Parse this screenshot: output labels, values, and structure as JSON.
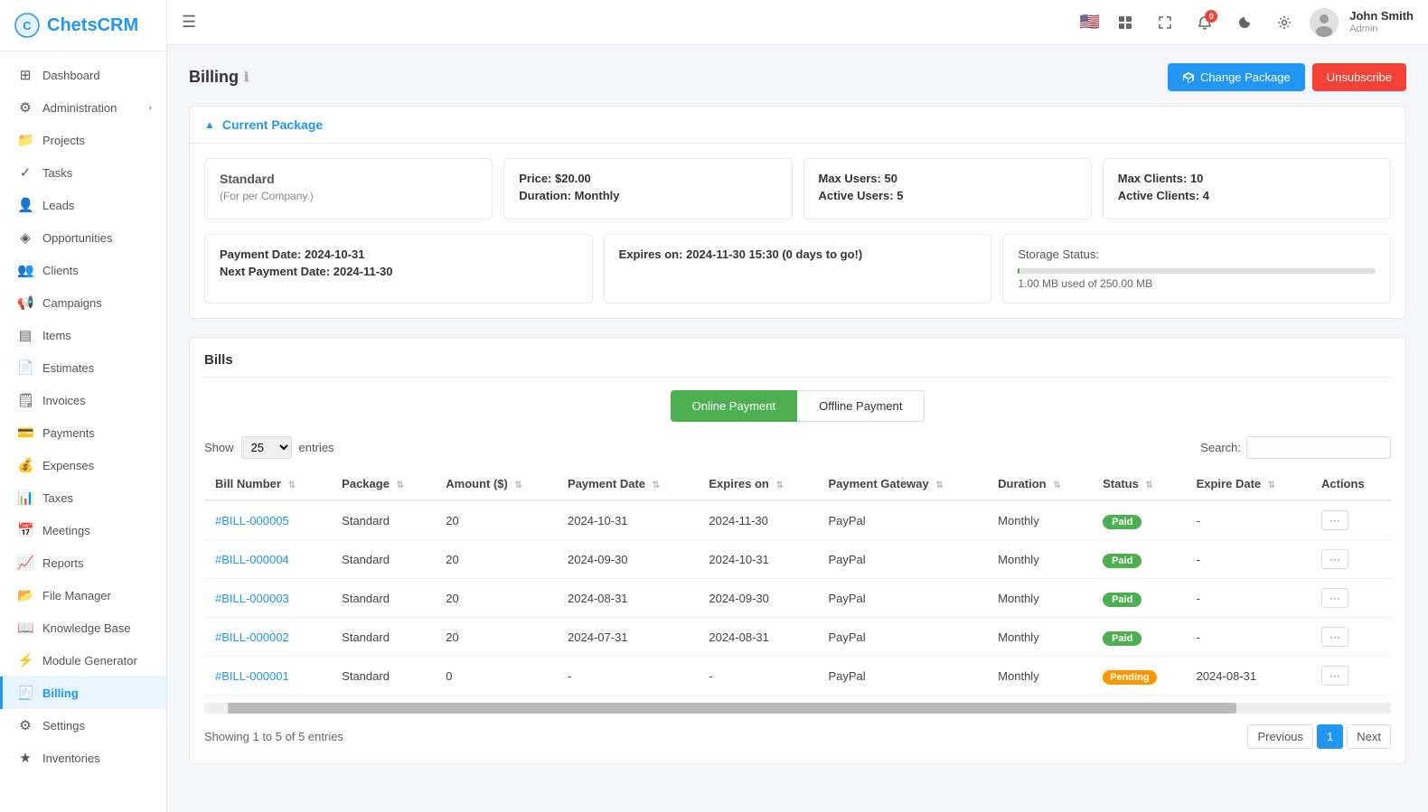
{
  "app": {
    "name": "ChetsCRM",
    "logo_text": "ChetsCRM"
  },
  "sidebar": {
    "items": [
      {
        "id": "dashboard",
        "label": "Dashboard",
        "icon": "⊞",
        "active": false
      },
      {
        "id": "administration",
        "label": "Administration",
        "icon": "⚙",
        "active": false,
        "has_arrow": true
      },
      {
        "id": "projects",
        "label": "Projects",
        "icon": "📁",
        "active": false
      },
      {
        "id": "tasks",
        "label": "Tasks",
        "icon": "✓",
        "active": false
      },
      {
        "id": "leads",
        "label": "Leads",
        "icon": "👤",
        "active": false
      },
      {
        "id": "opportunities",
        "label": "Opportunities",
        "icon": "◈",
        "active": false
      },
      {
        "id": "clients",
        "label": "Clients",
        "icon": "👥",
        "active": false
      },
      {
        "id": "campaigns",
        "label": "Campaigns",
        "icon": "📢",
        "active": false
      },
      {
        "id": "items",
        "label": "Items",
        "icon": "▤",
        "active": false
      },
      {
        "id": "estimates",
        "label": "Estimates",
        "icon": "📄",
        "active": false
      },
      {
        "id": "invoices",
        "label": "Invoices",
        "icon": "🗒",
        "active": false
      },
      {
        "id": "payments",
        "label": "Payments",
        "icon": "💳",
        "active": false
      },
      {
        "id": "expenses",
        "label": "Expenses",
        "icon": "💰",
        "active": false
      },
      {
        "id": "taxes",
        "label": "Taxes",
        "icon": "📊",
        "active": false
      },
      {
        "id": "meetings",
        "label": "Meetings",
        "icon": "📅",
        "active": false
      },
      {
        "id": "reports",
        "label": "Reports",
        "icon": "📈",
        "active": false
      },
      {
        "id": "file-manager",
        "label": "File Manager",
        "icon": "📂",
        "active": false
      },
      {
        "id": "knowledge-base",
        "label": "Knowledge Base",
        "icon": "📖",
        "active": false
      },
      {
        "id": "module-generator",
        "label": "Module Generator",
        "icon": "⚡",
        "active": false
      },
      {
        "id": "billing",
        "label": "Billing",
        "icon": "🧾",
        "active": true
      },
      {
        "id": "settings",
        "label": "Settings",
        "icon": "⚙",
        "active": false
      },
      {
        "id": "inventories",
        "label": "Inventories",
        "icon": "★",
        "active": false
      }
    ]
  },
  "header": {
    "hamburger_label": "☰",
    "flag": "🇺🇸",
    "apps_icon": "⊞",
    "expand_icon": "⛶",
    "notification_count": "0",
    "moon_icon": "☾",
    "settings_icon": "⚙",
    "user": {
      "name": "John Smith",
      "role": "Admin"
    }
  },
  "page": {
    "title": "Billing",
    "info_icon": "ℹ",
    "change_package_label": "Change Package",
    "unsubscribe_label": "Unsubscribe"
  },
  "current_package": {
    "section_title": "Current Package",
    "package_name": "Standard",
    "package_sub": "(For per Company.)",
    "price_label": "Price:",
    "price_value": "$20.00",
    "duration_label": "Duration:",
    "duration_value": "Monthly",
    "max_users_label": "Max Users:",
    "max_users_value": "50",
    "active_users_label": "Active Users:",
    "active_users_value": "5",
    "max_clients_label": "Max Clients:",
    "max_clients_value": "10",
    "active_clients_label": "Active Clients:",
    "active_clients_value": "4",
    "payment_date_label": "Payment Date:",
    "payment_date_value": "2024-10-31",
    "next_payment_label": "Next Payment Date:",
    "next_payment_value": "2024-11-30",
    "expires_label": "Expires on:",
    "expires_value": "2024-11-30 15:30 (0 days to go!)",
    "storage_label": "Storage Status:",
    "storage_used": "1.00 MB used of 250.00 MB",
    "storage_fill_percent": 0.4
  },
  "bills": {
    "title": "Bills",
    "online_payment_label": "Online Payment",
    "offline_payment_label": "Offline Payment",
    "show_label": "Show",
    "show_value": "25",
    "entries_label": "entries",
    "search_label": "Search:",
    "search_placeholder": "",
    "columns": [
      "Bill Number",
      "Package",
      "Amount ($)",
      "Payment Date",
      "Expires on",
      "Payment Gateway",
      "Duration",
      "Status",
      "Expire Date",
      "Actions"
    ],
    "rows": [
      {
        "bill_number": "#BILL-000005",
        "package": "Standard",
        "amount": "20",
        "payment_date": "2024-10-31",
        "expires_on": "2024-11-30",
        "gateway": "PayPal",
        "duration": "Monthly",
        "status": "Paid",
        "status_type": "paid",
        "expire_date": "-",
        "actions": "···"
      },
      {
        "bill_number": "#BILL-000004",
        "package": "Standard",
        "amount": "20",
        "payment_date": "2024-09-30",
        "expires_on": "2024-10-31",
        "gateway": "PayPal",
        "duration": "Monthly",
        "status": "Paid",
        "status_type": "paid",
        "expire_date": "-",
        "actions": "···"
      },
      {
        "bill_number": "#BILL-000003",
        "package": "Standard",
        "amount": "20",
        "payment_date": "2024-08-31",
        "expires_on": "2024-09-30",
        "gateway": "PayPal",
        "duration": "Monthly",
        "status": "Paid",
        "status_type": "paid",
        "expire_date": "-",
        "actions": "···"
      },
      {
        "bill_number": "#BILL-000002",
        "package": "Standard",
        "amount": "20",
        "payment_date": "2024-07-31",
        "expires_on": "2024-08-31",
        "gateway": "PayPal",
        "duration": "Monthly",
        "status": "Paid",
        "status_type": "paid",
        "expire_date": "-",
        "actions": "···"
      },
      {
        "bill_number": "#BILL-000001",
        "package": "Standard",
        "amount": "0",
        "payment_date": "-",
        "expires_on": "-",
        "gateway": "PayPal",
        "duration": "Monthly",
        "status": "Pending",
        "status_type": "pending",
        "expire_date": "2024-08-31",
        "actions": "···"
      }
    ],
    "showing_text": "Showing 1 to 5 of 5 entries",
    "previous_label": "Previous",
    "next_label": "Next",
    "page_number": "1"
  }
}
